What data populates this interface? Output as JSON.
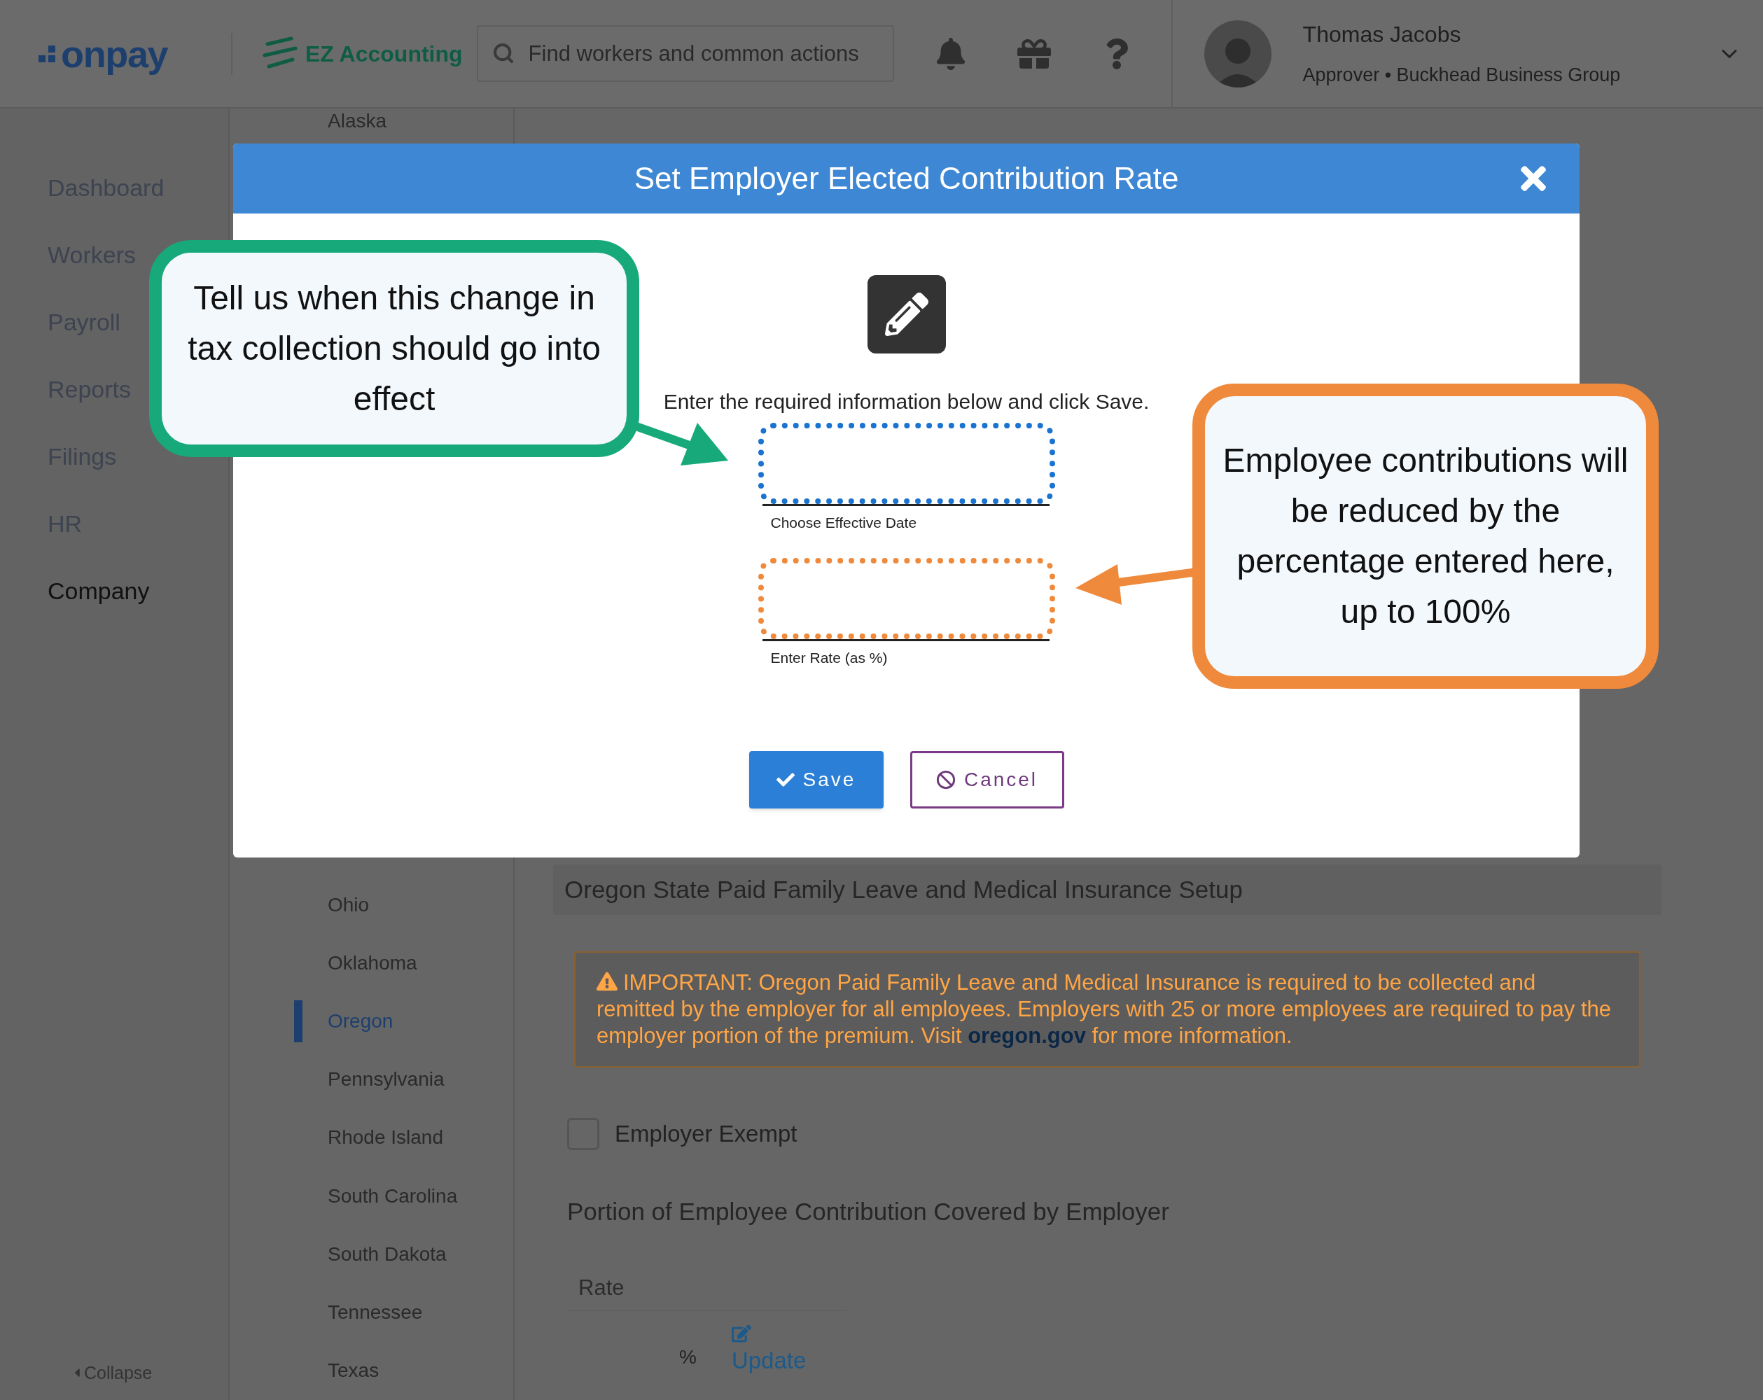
{
  "header": {
    "logo": "onpay",
    "partner_logo": "EZ Accounting",
    "search": {
      "placeholder": "Find workers and common actions"
    },
    "user": {
      "name": "Thomas Jacobs",
      "role": "Approver • Buckhead Business Group"
    }
  },
  "nav": {
    "items": [
      {
        "label": "Dashboard",
        "selected": false
      },
      {
        "label": "Workers",
        "selected": false
      },
      {
        "label": "Payroll",
        "selected": false
      },
      {
        "label": "Reports",
        "selected": false
      },
      {
        "label": "Filings",
        "selected": false
      },
      {
        "label": "HR",
        "selected": false
      },
      {
        "label": "Company",
        "selected": true
      }
    ],
    "collapse": "Collapse"
  },
  "states": [
    {
      "label": "Alaska",
      "selected": false
    },
    {
      "label": "Ohio",
      "selected": false
    },
    {
      "label": "Oklahoma",
      "selected": false
    },
    {
      "label": "Oregon",
      "selected": true
    },
    {
      "label": "Pennsylvania",
      "selected": false
    },
    {
      "label": "Rhode Island",
      "selected": false
    },
    {
      "label": "South Carolina",
      "selected": false
    },
    {
      "label": "South Dakota",
      "selected": false
    },
    {
      "label": "Tennessee",
      "selected": false
    },
    {
      "label": "Texas",
      "selected": false
    }
  ],
  "section": {
    "title": "Oregon State Paid Family Leave and Medical Insurance Setup",
    "warning": {
      "text": "IMPORTANT: Oregon Paid Family Leave and Medical Insurance is required to be collected and remitted by the employer for all employees. Employers with 25 or more employees are required to pay the employer portion of the premium. Visit",
      "link": "oregon.gov",
      "text_after": "for more information."
    },
    "employer_exempt": {
      "label": "Employer Exempt",
      "checked": false
    },
    "portion_title": "Portion of Employee Contribution Covered by Employer",
    "table": {
      "column": "Rate",
      "suffix": "%",
      "action": "Update"
    }
  },
  "modal": {
    "title": "Set Employer Elected Contribution Rate",
    "instruction": "Enter the required information below and click Save.",
    "fields": [
      {
        "label": "Choose Effective Date",
        "color": "#1a73d0"
      },
      {
        "label": "Enter Rate (as %)",
        "color": "#ef8a3c"
      }
    ],
    "buttons": [
      {
        "label": "Save",
        "kind": "primary"
      },
      {
        "label": "Cancel",
        "kind": "secondary"
      }
    ]
  },
  "callouts": [
    {
      "text": "Tell us when this change in tax collection should go into effect",
      "color": "#17a97a"
    },
    {
      "text": "Employee contributions will be reduced by the percentage entered here, up to 100%",
      "color": "#ef8a3c"
    }
  ]
}
